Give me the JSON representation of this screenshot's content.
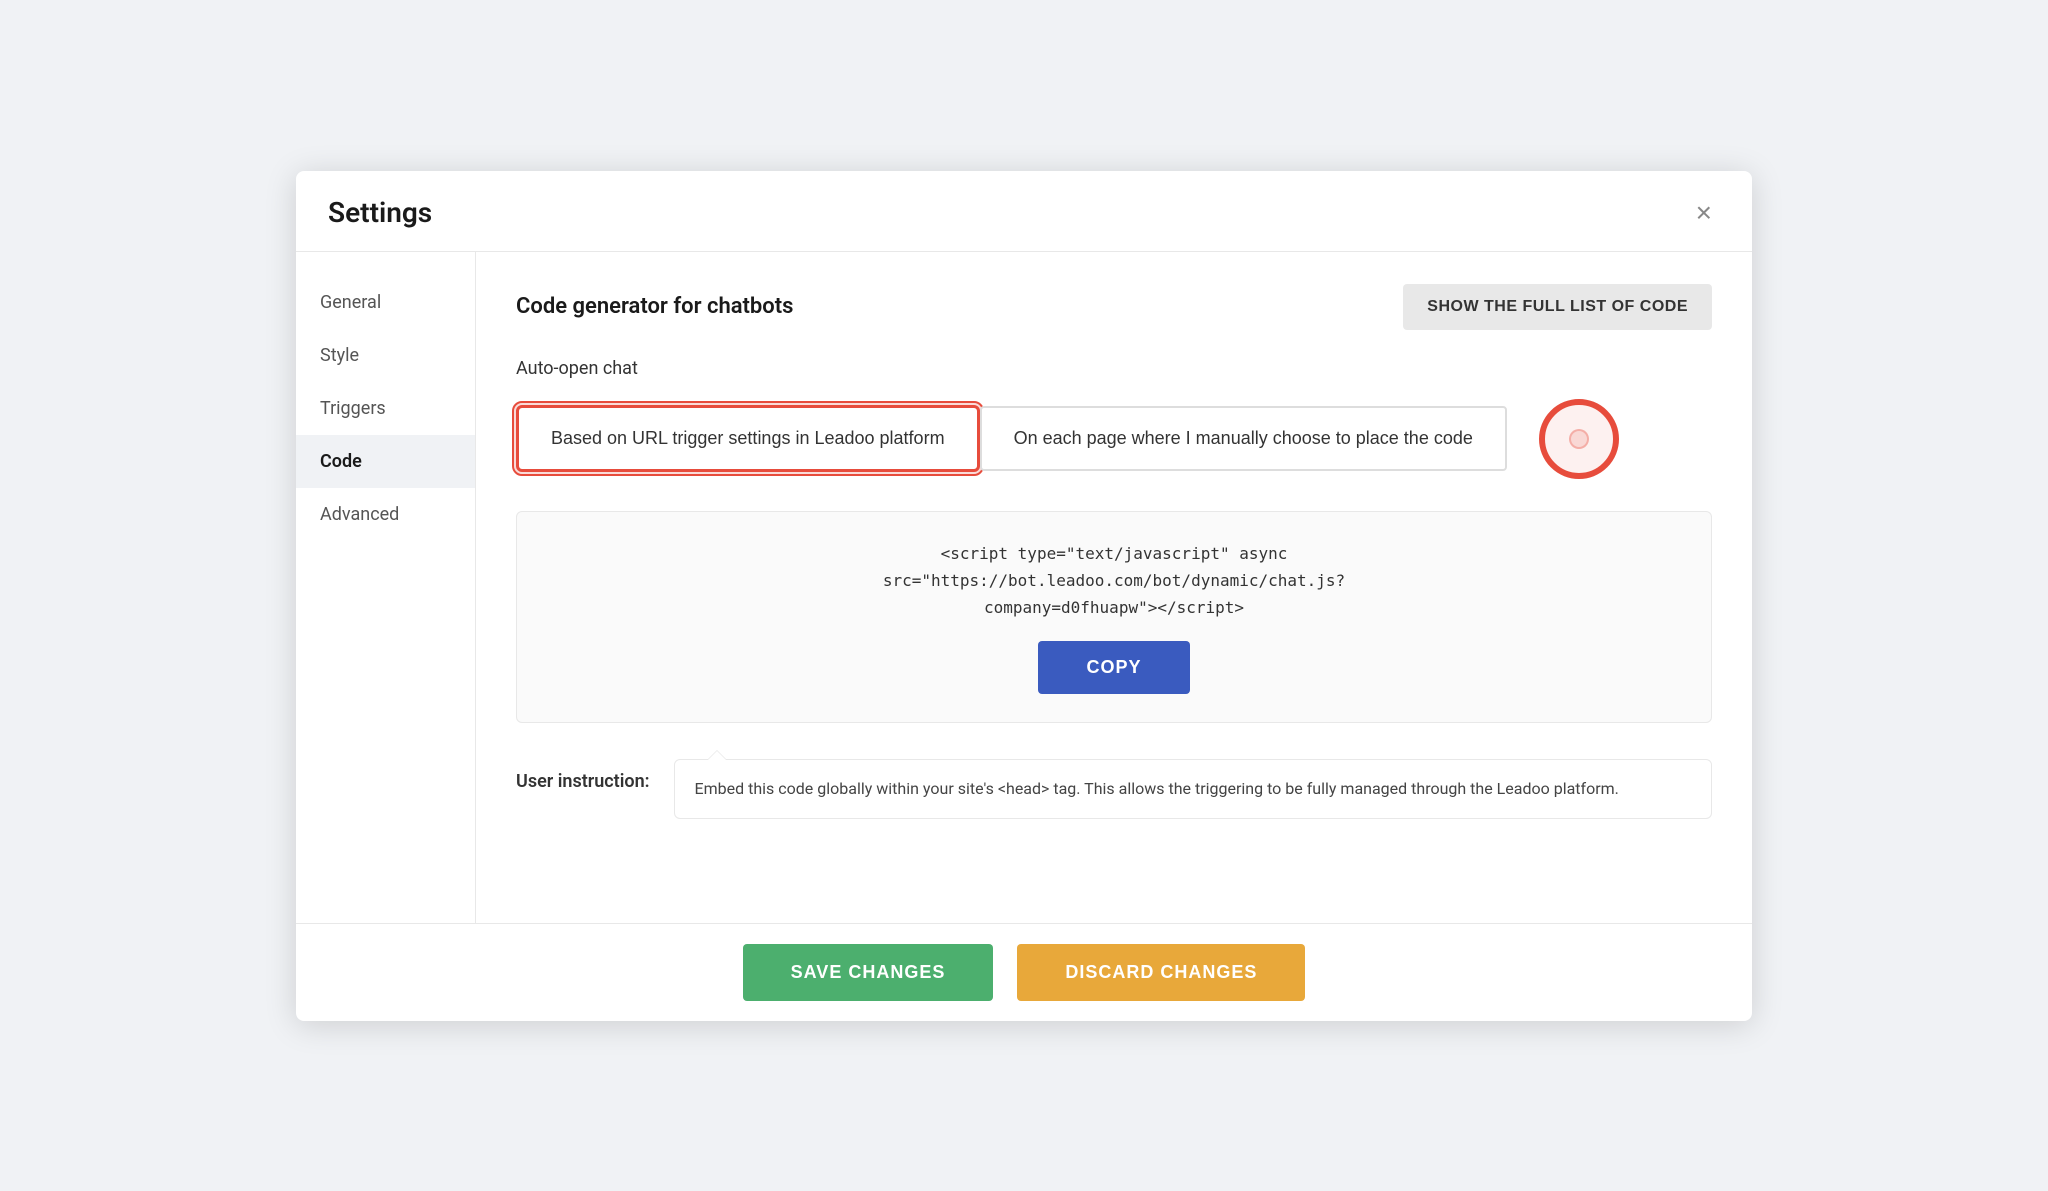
{
  "modal": {
    "title": "Settings",
    "close_label": "×"
  },
  "sidebar": {
    "items": [
      {
        "label": "General",
        "active": false
      },
      {
        "label": "Style",
        "active": false
      },
      {
        "label": "Triggers",
        "active": false
      },
      {
        "label": "Code",
        "active": true
      },
      {
        "label": "Advanced",
        "active": false
      }
    ]
  },
  "main": {
    "section_title": "Code generator for chatbots",
    "show_full_list_btn": "SHOW THE FULL LIST OF CODE",
    "auto_open_label": "Auto-open chat",
    "option1_label": "Based on URL trigger settings in Leadoo platform",
    "option2_label": "On each page where I manually choose to place the code",
    "code_text": "<script type=\"text/javascript\" async src=\"https://bot.leadoo.com/bot/dynamic/chat.js?company=d0fhuapw\"><\\/script>",
    "copy_btn": "COPY",
    "user_instruction_label": "User instruction:",
    "user_instruction_text": "Embed this code globally within your site's <head> tag. This allows the triggering to be fully managed through the Leadoo platform."
  },
  "footer": {
    "save_btn": "SAVE CHANGES",
    "discard_btn": "DISCARD CHANGES"
  }
}
